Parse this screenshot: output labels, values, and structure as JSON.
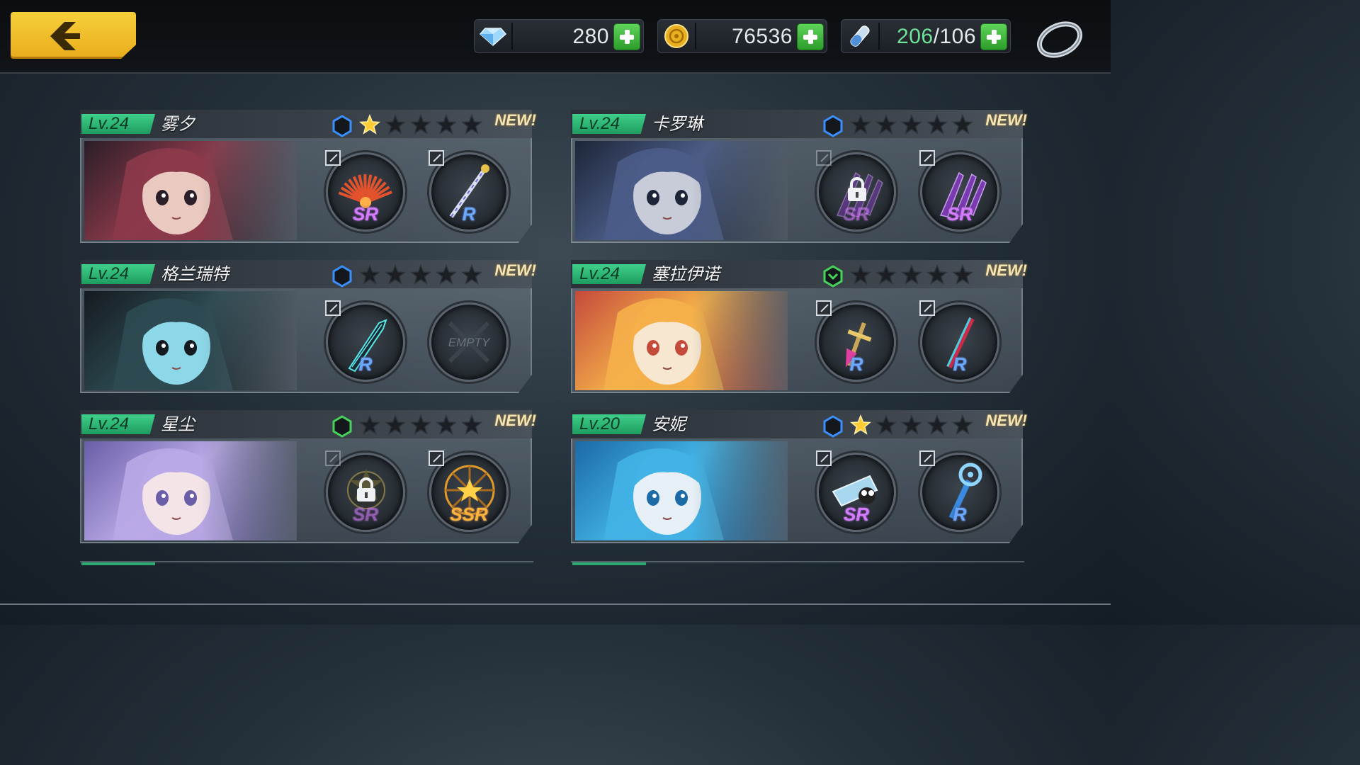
{
  "currencies": [
    {
      "icon": "diamond-icon",
      "value": "280",
      "type": "gems"
    },
    {
      "icon": "gold-coin-icon",
      "value": "76536",
      "type": "gold"
    },
    {
      "icon": "stamina-vial-icon",
      "current": "206",
      "max": "/106",
      "type": "stamina"
    }
  ],
  "characters": [
    {
      "level": "Lv.24",
      "name": "雾夕",
      "hex_color": "#3a8fff",
      "stars_lit": 1,
      "new_tag": "NEW!",
      "portrait_colors": [
        "#2a1e28",
        "#8c3a4a",
        "#e9c9c0"
      ],
      "slots": [
        {
          "rarity": "SR",
          "type": "weapon",
          "art": "fan-weapon-icon",
          "locked": false,
          "edit": true
        },
        {
          "rarity": "R",
          "type": "weapon",
          "art": "staff-weapon-icon",
          "locked": false,
          "edit": true
        }
      ]
    },
    {
      "level": "Lv.24",
      "name": "卡罗琳",
      "hex_color": "#3a8fff",
      "stars_lit": 0,
      "new_tag": "NEW!",
      "portrait_colors": [
        "#1d2638",
        "#4b5c88",
        "#c8ccd8"
      ],
      "slots": [
        {
          "rarity": "SR",
          "type": "weapon",
          "art": "claw-weapon-icon",
          "locked": true,
          "edit": true
        },
        {
          "rarity": "SR",
          "type": "weapon",
          "art": "claw-weapon-icon",
          "locked": false,
          "edit": true
        }
      ]
    },
    {
      "level": "Lv.24",
      "name": "格兰瑞特",
      "hex_color": "#3a8fff",
      "stars_lit": 0,
      "new_tag": "NEW!",
      "portrait_colors": [
        "#151b20",
        "#2d4a52",
        "#8dd8e8"
      ],
      "slots": [
        {
          "rarity": "R",
          "type": "weapon",
          "art": "blade-weapon-icon",
          "locked": false,
          "edit": true
        },
        {
          "rarity": "",
          "type": "empty",
          "art": "",
          "locked": false,
          "edit": false,
          "empty_label": "EMPTY"
        }
      ]
    },
    {
      "level": "Lv.24",
      "name": "塞拉伊诺",
      "hex_color": "#45d35a",
      "stars_lit": 0,
      "new_tag": "NEW!",
      "portrait_colors": [
        "#c44a3a",
        "#f5b04a",
        "#f7e7d0"
      ],
      "slots": [
        {
          "rarity": "R",
          "type": "weapon",
          "art": "sword-weapon-icon",
          "locked": false,
          "edit": true
        },
        {
          "rarity": "R",
          "type": "weapon",
          "art": "lance-weapon-icon",
          "locked": false,
          "edit": true
        }
      ]
    },
    {
      "level": "Lv.24",
      "name": "星尘",
      "hex_color": "#45d35a",
      "stars_lit": 0,
      "new_tag": "NEW!",
      "portrait_colors": [
        "#6a5ea8",
        "#b9a9e6",
        "#f4e4e8"
      ],
      "slots": [
        {
          "rarity": "SR",
          "type": "weapon",
          "art": "mace-weapon-icon",
          "locked": true,
          "edit": true
        },
        {
          "rarity": "SSR",
          "type": "weapon",
          "art": "sun-weapon-icon",
          "locked": false,
          "edit": true
        }
      ]
    },
    {
      "level": "Lv.20",
      "name": "安妮",
      "hex_color": "#3a8fff",
      "stars_lit": 1,
      "new_tag": "NEW!",
      "portrait_colors": [
        "#1c6aa6",
        "#42b3e6",
        "#e6f0f6"
      ],
      "slots": [
        {
          "rarity": "SR",
          "type": "weapon",
          "art": "cannon-weapon-icon",
          "locked": false,
          "edit": true
        },
        {
          "rarity": "R",
          "type": "weapon",
          "art": "key-weapon-icon",
          "locked": false,
          "edit": true
        }
      ]
    }
  ]
}
